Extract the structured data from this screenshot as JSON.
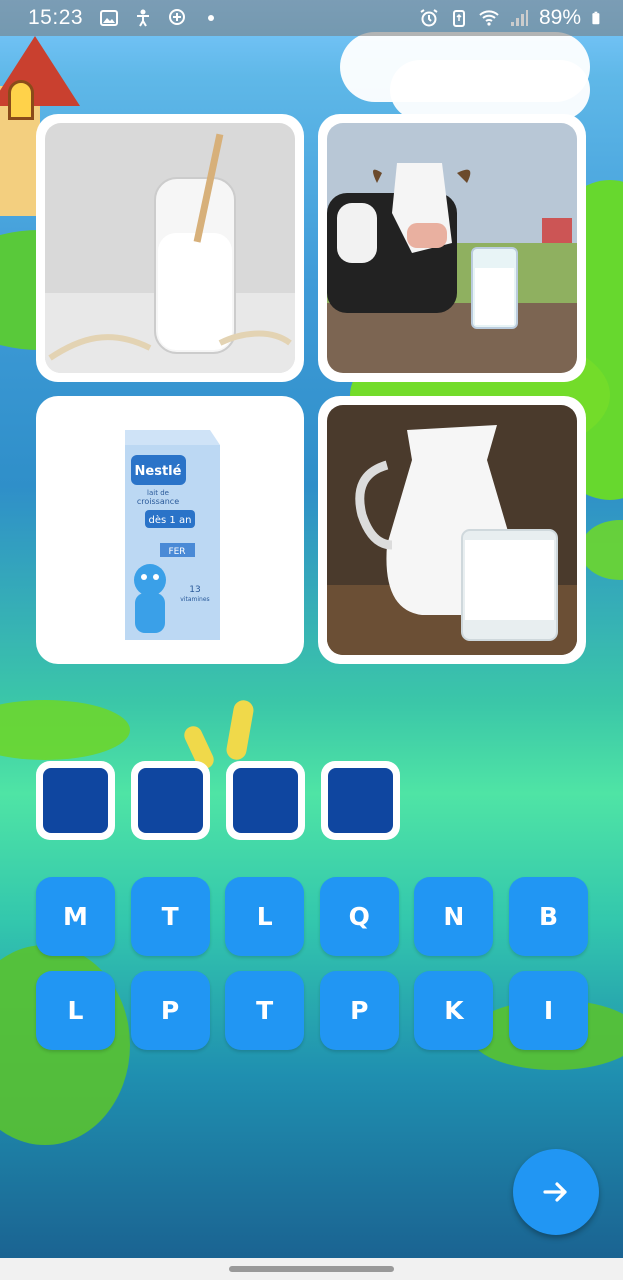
{
  "status_bar": {
    "time": "15:23",
    "left_icons": [
      "gallery-icon",
      "accessibility-icon",
      "plus-circle-icon",
      "dot-icon"
    ],
    "right_icons": [
      "alarm-icon",
      "recycle-icon",
      "wifi-icon",
      "signal-icon",
      "battery-icon"
    ],
    "battery_percent": "89%"
  },
  "puzzle": {
    "images": [
      {
        "name": "milk-bottle-oats",
        "subject": "milk bottle with straw and oats"
      },
      {
        "name": "cow-with-milk-glass",
        "subject": "cow with glass of milk"
      },
      {
        "name": "milk-carton",
        "subject": "milk carton",
        "carton_text": {
          "brand": "Nestlé",
          "line1": "lait de",
          "line2": "croissance",
          "age": "dès 1 an",
          "badge": "FER",
          "vit": "13",
          "vit_label": "vitamines"
        }
      },
      {
        "name": "milk-jug-glass",
        "subject": "milk jug and glass"
      }
    ],
    "answer_slots": [
      "",
      "",
      "",
      ""
    ],
    "letters": [
      "M",
      "T",
      "L",
      "Q",
      "N",
      "B",
      "L",
      "P",
      "T",
      "P",
      "K",
      "I"
    ]
  },
  "colors": {
    "slot_fill": "#0f46a0",
    "key_fill": "#2196f3",
    "fab_fill": "#2196f3"
  },
  "fab": {
    "icon": "arrow-right-icon"
  }
}
